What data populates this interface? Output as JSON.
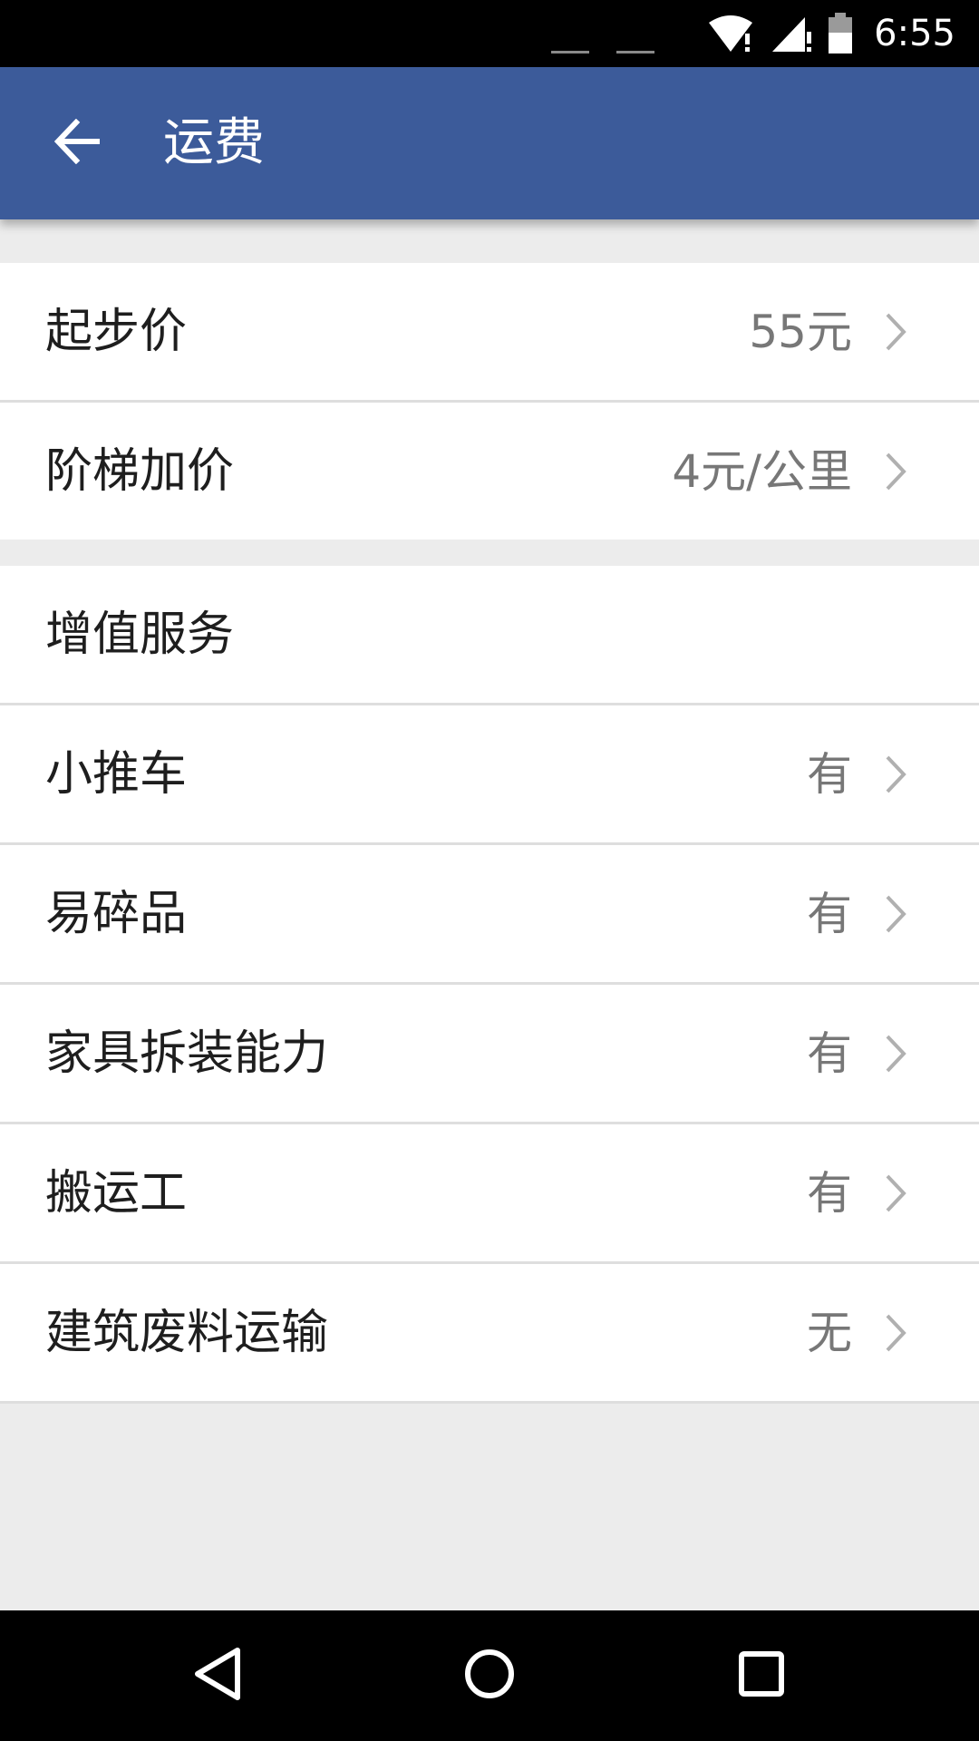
{
  "status_bar": {
    "time": "6:55",
    "icons": [
      "wifi-alert-icon",
      "cell-signal-alert-icon",
      "battery-icon"
    ]
  },
  "app_bar": {
    "title": "运费",
    "back_icon": "arrow-left-icon",
    "color": "#3c5b9a"
  },
  "pricing": [
    {
      "label": "起步价",
      "value": "55元"
    },
    {
      "label": "阶梯加价",
      "value": "4元/公里"
    }
  ],
  "services": {
    "header": "增值服务",
    "items": [
      {
        "label": "小推车",
        "value": "有"
      },
      {
        "label": "易碎品",
        "value": "有"
      },
      {
        "label": "家具拆装能力",
        "value": "有"
      },
      {
        "label": "搬运工",
        "value": "有"
      },
      {
        "label": "建筑废料运输",
        "value": "无"
      }
    ]
  },
  "nav_bar": {
    "buttons": [
      "triangle-back-icon",
      "circle-home-icon",
      "square-recents-icon"
    ]
  }
}
